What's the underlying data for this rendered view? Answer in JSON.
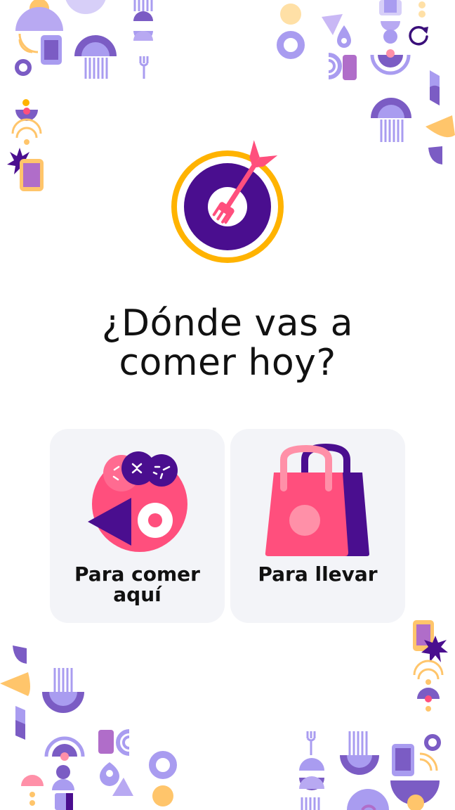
{
  "screen": {
    "question": "¿Dónde vas a comer hoy?"
  },
  "options": [
    {
      "id": "dine-in",
      "label": "Para comer aquí",
      "icon": "dine-in-plate-icon"
    },
    {
      "id": "take-away",
      "label": "Para llevar",
      "icon": "shopping-bag-icon"
    }
  ],
  "toolbar": {
    "refresh_icon": "refresh-icon"
  },
  "brand": {
    "logo_icon": "target-fork-logo"
  },
  "colors": {
    "purple_dark": "#4a0e8f",
    "purple_mid": "#7b5cc4",
    "lavender": "#a99cf0",
    "pink": "#ff4f7d",
    "orange": "#ffb300",
    "peach": "#ffc56b",
    "card_bg": "#f3f4f8",
    "text": "#111111"
  }
}
